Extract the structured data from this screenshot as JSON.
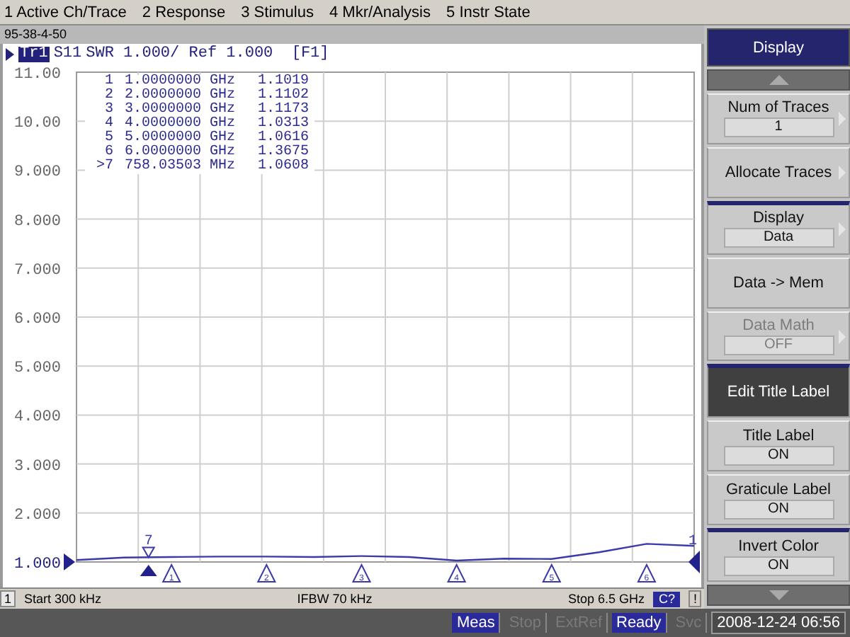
{
  "menu": [
    {
      "label": "1 Active Ch/Trace"
    },
    {
      "label": "2 Response"
    },
    {
      "label": "3 Stimulus"
    },
    {
      "label": "4 Mkr/Analysis"
    },
    {
      "label": "5 Instr State"
    }
  ],
  "window": {
    "title": "95-38-4-50"
  },
  "trace": {
    "label": "Tr1",
    "selected": true,
    "text": "SWR 1.000/ Ref 1.000  [F1]"
  },
  "marker_list": [
    {
      "number": "1",
      "stimulus": "1.0000000 GHz",
      "value": "1.1019"
    },
    {
      "number": "2",
      "stimulus": "2.0000000 GHz",
      "value": "1.1102"
    },
    {
      "number": "3",
      "stimulus": "3.0000000 GHz",
      "value": "1.1173"
    },
    {
      "number": "4",
      "stimulus": "4.0000000 GHz",
      "value": "1.0313"
    },
    {
      "number": "5",
      "stimulus": "5.0000000 GHz",
      "value": "1.0616"
    },
    {
      "number": "6",
      "stimulus": "6.0000000 GHz",
      "value": "1.3675"
    },
    {
      "number": ">7",
      "stimulus": "758.03503 MHz",
      "value": "1.0608"
    }
  ],
  "chart": {
    "trace_end_label": "1",
    "markers": [
      {
        "label": "1",
        "selected": false
      },
      {
        "label": "2",
        "selected": false
      },
      {
        "label": "3",
        "selected": false
      },
      {
        "label": "4",
        "selected": false
      },
      {
        "label": "5",
        "selected": false
      },
      {
        "label": "6",
        "selected": false
      },
      {
        "label": "7",
        "selected": true
      }
    ],
    "chart_data": {
      "type": "line",
      "ylim": [
        1,
        11
      ],
      "grid": true,
      "yticks": [
        {
          "value": 11,
          "label": "11.00"
        },
        {
          "value": 10,
          "label": "10.00"
        },
        {
          "value": 9,
          "label": "9.000"
        },
        {
          "value": 8,
          "label": "8.000"
        },
        {
          "value": 7,
          "label": "7.000"
        },
        {
          "value": 6,
          "label": "6.000"
        },
        {
          "value": 5,
          "label": "5.000"
        },
        {
          "value": 4,
          "label": "4.000"
        },
        {
          "value": 3,
          "label": "3.000"
        },
        {
          "value": 2,
          "label": "2.000"
        },
        {
          "value": 1,
          "label": "1.000"
        }
      ],
      "categories": [
        null,
        null,
        null,
        null,
        null,
        null,
        null,
        null,
        null,
        null,
        null,
        null,
        null,
        null
      ],
      "series": [
        {
          "name": "S11",
          "color": "#3a3aa8",
          "values": [
            1.04,
            1.09,
            1.1,
            1.11,
            1.11,
            1.1,
            1.12,
            1.1,
            1.03,
            1.07,
            1.06,
            1.2,
            1.37,
            1.33
          ]
        }
      ]
    }
  },
  "channel_bar": {
    "channel": "1",
    "start": "Start 300 kHz",
    "ifbw": "IFBW 70 kHz",
    "stop": "Stop 6.5 GHz",
    "cal": "C?",
    "warning": "!"
  },
  "softkeys": [
    {
      "kind": "header",
      "label": "Display"
    },
    {
      "kind": "scroll-up"
    },
    {
      "kind": "key",
      "label": "Num of Traces",
      "value": "1",
      "submenu": true,
      "disabled": false,
      "selected": false,
      "group_start": false
    },
    {
      "kind": "key",
      "label": "Allocate Traces",
      "submenu": true,
      "disabled": false,
      "selected": false,
      "group_start": false
    },
    {
      "kind": "key",
      "label": "Display",
      "value": "Data",
      "submenu": true,
      "disabled": false,
      "selected": false,
      "group_start": true
    },
    {
      "kind": "key",
      "label": "Data -> Mem",
      "submenu": false,
      "disabled": false,
      "selected": false,
      "group_start": false
    },
    {
      "kind": "key",
      "label": "Data Math",
      "value": "OFF",
      "submenu": true,
      "disabled": true,
      "selected": false,
      "group_start": false
    },
    {
      "kind": "key",
      "label": "Edit Title Label",
      "submenu": false,
      "disabled": false,
      "selected": true,
      "group_start": true
    },
    {
      "kind": "key",
      "label": "Title Label",
      "value": "ON",
      "submenu": false,
      "disabled": false,
      "selected": false,
      "group_start": false
    },
    {
      "kind": "key",
      "label": "Graticule Label",
      "value": "ON",
      "submenu": false,
      "disabled": false,
      "selected": false,
      "group_start": false
    },
    {
      "kind": "key",
      "label": "Invert Color",
      "value": "ON",
      "submenu": false,
      "disabled": false,
      "selected": false,
      "group_start": true
    },
    {
      "kind": "scroll-down"
    }
  ],
  "status_bar": [
    {
      "label": "Meas",
      "on": true
    },
    {
      "label": "Stop",
      "on": false
    },
    {
      "label": "ExtRef",
      "on": false
    },
    {
      "label": "Ready",
      "on": true
    },
    {
      "label": "Svc",
      "on": false
    },
    {
      "label": "2008-12-24 06:56",
      "kind": "clock"
    }
  ]
}
